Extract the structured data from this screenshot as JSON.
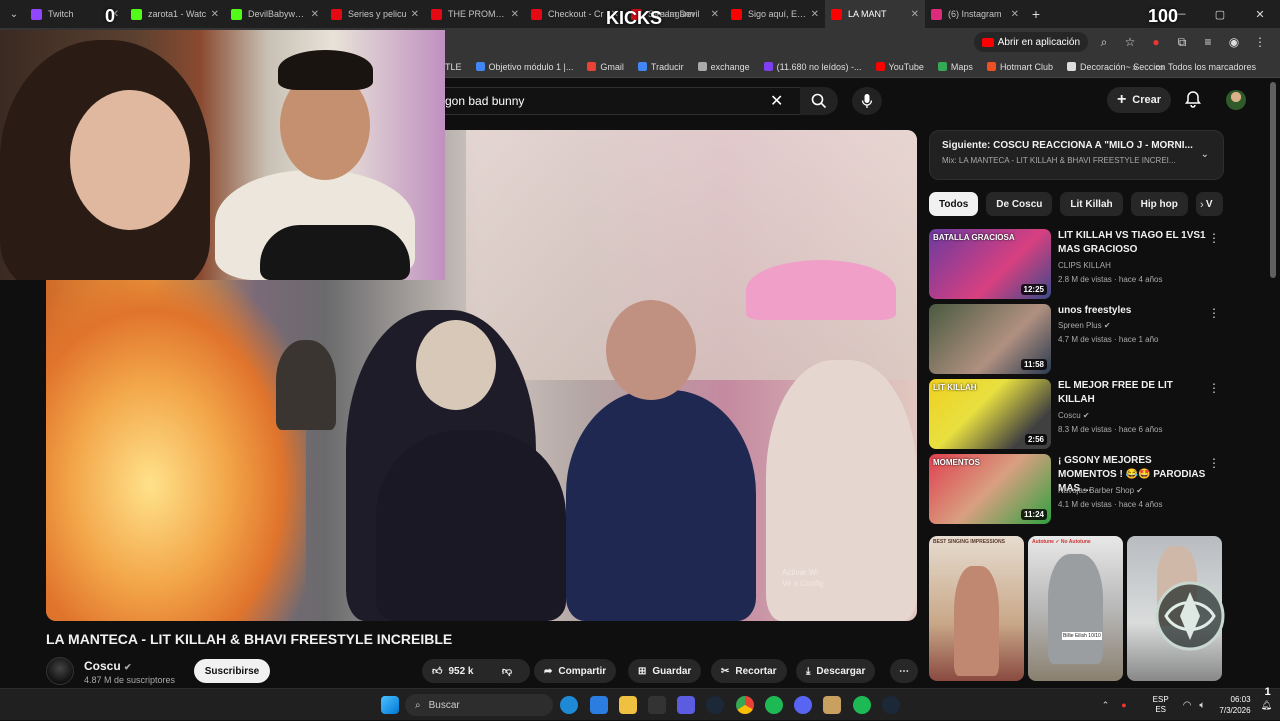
{
  "browser": {
    "tabs": [
      {
        "title": "Twitch",
        "color": "#9146ff"
      },
      {
        "title": "zarota1 - Watc",
        "color": "#53fc18"
      },
      {
        "title": "DevilBabywg C",
        "color": "#53fc18"
      },
      {
        "title": "Series y pelicu",
        "color": "#e50914"
      },
      {
        "title": "THE PROMISE",
        "color": "#e50914"
      },
      {
        "title": "Checkout - Cr",
        "color": "#e50914"
      },
      {
        "title": "Stream Devil",
        "color": "#e50914"
      },
      {
        "title": "Sigo aquí, El A",
        "color": "#ff0000"
      },
      {
        "title": "LA MANT",
        "color": "#ff0000"
      },
      {
        "title": "(6) Instagram",
        "color": "#dd2a7b"
      }
    ],
    "hidden_tab_text": "en lagann",
    "open_app_label": "Abrir en aplicación",
    "bookmarks": [
      {
        "label": "TLE",
        "color": ""
      },
      {
        "label": "Objetivo módulo 1 |...",
        "color": "#4285f4"
      },
      {
        "label": "Gmail",
        "color": "#ea4335"
      },
      {
        "label": "Traducir",
        "color": "#4285f4"
      },
      {
        "label": "exchange",
        "color": "#aaaaaa"
      },
      {
        "label": "(11.680 no leídos) -...",
        "color": "#7e3ff2"
      },
      {
        "label": "YouTube",
        "color": "#ff0000"
      },
      {
        "label": "Maps",
        "color": "#34a853"
      },
      {
        "label": "Hotmart Club",
        "color": "#f04e23"
      },
      {
        "label": "Decoración~ Seccion",
        "color": "#dddddd"
      }
    ],
    "all_bookmarks_label": "Todos los marcadores"
  },
  "overlay": {
    "score_left": "0",
    "kicks_label": "KICKS",
    "score_right": "100"
  },
  "youtube": {
    "search_query": "gon bad bunny",
    "create_label": "Crear",
    "video_title": "LA MANTECA - LIT KILLAH & BHAVI FREESTYLE INCREIBLE",
    "channel_name": "Coscu",
    "subscribers": "4.87 M de suscriptores",
    "subscribe_label": "Suscribirse",
    "likes": "952 k",
    "share_label": "Compartir",
    "save_label": "Guardar",
    "clip_label": "Recortar",
    "download_label": "Descargar",
    "watermark_line1": "Activar Wi",
    "watermark_line2": "Ve a Config",
    "up_next": {
      "title": "Siguiente: COSCU REACCIONA A \"MILO J - MORNI...",
      "subtitle": "Mix: LA MANTECA - LIT KILLAH & BHAVI FREESTYLE INCREI..."
    },
    "chips": [
      "Todos",
      "De Coscu",
      "Lit Killah",
      "Hip hop",
      "V"
    ],
    "recommendations": [
      {
        "title": "LIT KILLAH VS TIAGO EL 1VS1 MAS GRACIOSO",
        "channel": "CLIPS KILLAH",
        "verified": false,
        "meta": "2.8 M de vistas · hace 4 años",
        "duration": "12:25",
        "thumb_text": "BATALLA GRACIOSA"
      },
      {
        "title": "unos freestyles",
        "channel": "Spreen Plus",
        "verified": true,
        "meta": "4.7 M de vistas · hace 1 año",
        "duration": "11:58",
        "thumb_text": ""
      },
      {
        "title": "EL MEJOR FREE DE LIT KILLAH",
        "channel": "Coscu",
        "verified": true,
        "meta": "8.3 M de vistas · hace 6 años",
        "duration": "2:56",
        "thumb_text": "LIT KILLAH"
      },
      {
        "title": "¡ GSONY MEJORES MOMENTOS ! 😂🤩 PARODIAS MAS ...",
        "channel": "Navajas Barber Shop",
        "verified": true,
        "meta": "4.1 M de vistas · hace 4 años",
        "duration": "11:24",
        "thumb_text": "MOMENTOS"
      }
    ],
    "shorts": [
      {
        "top_text": "BEST SINGING IMPRESSIONS",
        "bottom_text": ""
      },
      {
        "top_text": "Autotune ✓   No Autotune",
        "bottom_text": "Billie Eilish 10/10"
      },
      {
        "top_text": "",
        "bottom_text": ""
      }
    ]
  },
  "taskbar": {
    "search_placeholder": "Buscar",
    "lang_top": "ESP",
    "lang_bottom": "ES",
    "time": "06:03",
    "date": "7/3/2026",
    "notif_count": "1"
  }
}
